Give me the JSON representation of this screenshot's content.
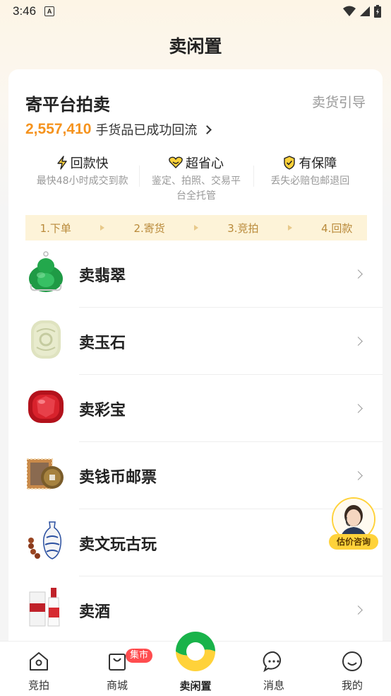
{
  "status_bar": {
    "time": "3:46",
    "notification_icon": "a-icon",
    "icons": [
      "wifi-icon",
      "signal-icon",
      "battery-icon"
    ]
  },
  "header": {
    "title": "卖闲置"
  },
  "card": {
    "title": "寄平台拍卖",
    "guide_link": "卖货引导",
    "stat_number": "2,557,410",
    "stat_text": "手货品已成功回流",
    "features": [
      {
        "icon": "lightning-icon",
        "title": "回款快",
        "desc": "最快48小时成交到款"
      },
      {
        "icon": "heart-icon",
        "title": "超省心",
        "desc": "鉴定、拍照、交易平台全托管"
      },
      {
        "icon": "shield-check-icon",
        "title": "有保障",
        "desc": "丢失必赔包邮退回"
      }
    ],
    "steps": [
      "1.下单",
      "2.寄货",
      "3.竞拍",
      "4.回款"
    ],
    "categories": [
      {
        "label": "卖翡翠",
        "icon": "jade-buddha-icon"
      },
      {
        "label": "卖玉石",
        "icon": "jade-stone-icon"
      },
      {
        "label": "卖彩宝",
        "icon": "ruby-icon"
      },
      {
        "label": "卖钱币邮票",
        "icon": "coin-stamp-icon"
      },
      {
        "label": "卖文玩古玩",
        "icon": "antique-vase-icon"
      },
      {
        "label": "卖酒",
        "icon": "liquor-bottle-icon"
      }
    ]
  },
  "floating": {
    "consult_label": "估价咨询"
  },
  "tabbar": {
    "items": [
      {
        "label": "竞拍",
        "icon": "home-icon"
      },
      {
        "label": "商城",
        "icon": "bag-icon",
        "badge": "集市"
      },
      {
        "label": "卖闲置",
        "icon": "sell-logo-icon"
      },
      {
        "label": "消息",
        "icon": "chat-icon"
      },
      {
        "label": "我的",
        "icon": "smile-icon"
      }
    ]
  },
  "colors": {
    "accent_orange": "#f5931e",
    "steps_bg": "#fdf3d8",
    "brand_yellow": "#ffd23a",
    "brand_green": "#19b34a",
    "badge_red": "#ff4d4f"
  }
}
